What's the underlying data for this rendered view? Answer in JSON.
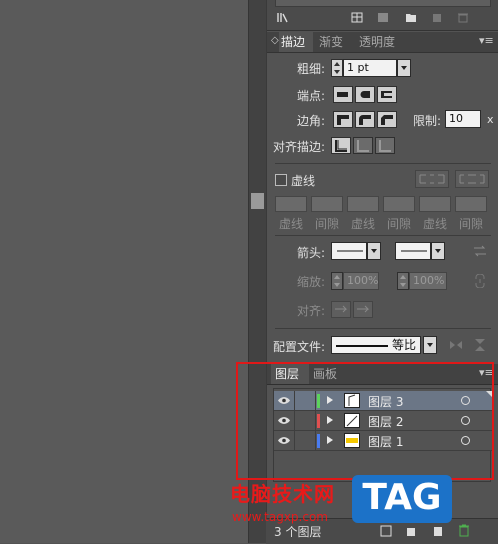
{
  "stroke_panel": {
    "tabs": [
      "描边",
      "渐变",
      "透明度"
    ],
    "weight_label": "粗细:",
    "weight_value": "1 pt",
    "cap_label": "端点:",
    "corner_label": "边角:",
    "limit_label": "限制:",
    "limit_value": "10",
    "limit_unit": "x",
    "align_label": "对齐描边:",
    "dashed_label": "虚线",
    "dash_labels": [
      "虚线",
      "间隙",
      "虚线",
      "间隙",
      "虚线",
      "间隙"
    ],
    "arrow_label": "箭头:",
    "scale_label": "缩放:",
    "scale_start": "100%",
    "scale_end": "100%",
    "arrow_align_label": "对齐:",
    "profile_label": "配置文件:",
    "profile_value": "等比"
  },
  "layers_panel": {
    "tabs": [
      "图层",
      "画板"
    ],
    "layers": [
      {
        "name": "图层 3",
        "color": "#5cd35c",
        "selected": true
      },
      {
        "name": "图层 2",
        "color": "#e05050",
        "selected": false
      },
      {
        "name": "图层 1",
        "color": "#4a7cf0",
        "selected": false
      }
    ],
    "status": "3 个图层"
  },
  "watermark": {
    "title": "电脑技术网",
    "url": "www.tagxp.com",
    "badge": "TAG"
  },
  "colors": {
    "highlight_box": "#e01818",
    "selected_row": "#6b7686"
  }
}
